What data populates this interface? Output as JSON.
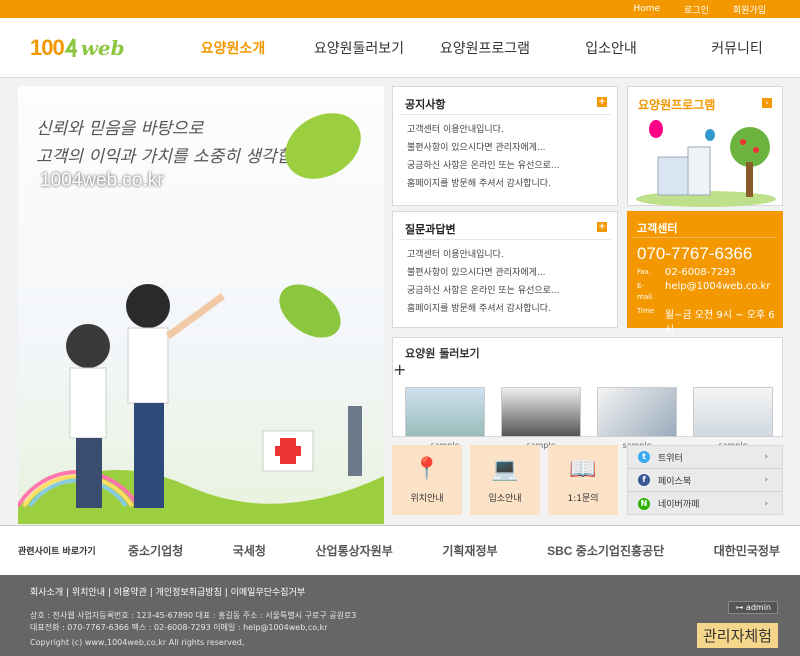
{
  "topbar": {
    "home": "Home",
    "login": "로그인",
    "join": "회원가입",
    "accent": "#f39800"
  },
  "logo": {
    "num": "100",
    "word": "web"
  },
  "nav": {
    "items": [
      "요양원소개",
      "요양원둘러보기",
      "요양원프로그램",
      "입소안내",
      "커뮤니티"
    ]
  },
  "hero": {
    "slogan1": "신뢰와 믿음을 바탕으로",
    "slogan2": "고객의 이익과 가치를 소중히 생각합니다",
    "url": "1004web.co.kr"
  },
  "notice": {
    "title": "공지사항",
    "items": [
      "고객센터 이용안내입니다.",
      "불편사항이 있으시다면 관리자에게...",
      "궁금하신 사항은 온라인 또는 유선으로...",
      "홈페이지를 방문해 주셔서 감사합니다."
    ]
  },
  "qna": {
    "title": "질문과답변",
    "items": [
      "고객센터 이용안내입니다.",
      "불편사항이 있으시다면 관리자에게...",
      "궁금하신 사항은 온라인 또는 유선으로...",
      "홈페이지를 방문해 주셔서 감사합니다."
    ]
  },
  "program": {
    "title": "요양원프로그램"
  },
  "cs": {
    "title": "고객센터",
    "tel": "070-7767-6366",
    "fax_label": "Fax.",
    "fax": "02-6008-7293",
    "email_label": "E-mail.",
    "email": "help@1004web.co.kr",
    "time_label": "Time",
    "time": "월~금 오전 9시 ~ 오후 6시"
  },
  "tour": {
    "title": "요양원 둘러보기",
    "captions": [
      "sample",
      "sample",
      "sample",
      "sample"
    ]
  },
  "quick": {
    "items": [
      "위치안내",
      "입소안내",
      "1:1문의"
    ]
  },
  "sns": {
    "items": [
      "트위터",
      "페이스북",
      "네이버까페"
    ]
  },
  "related": {
    "title": "관련사이트 바로가기",
    "logos": [
      "중소기업청",
      "국세청",
      "산업통상자원부",
      "기획재정부",
      "SBC 중소기업진흥공단",
      "대한민국정부"
    ]
  },
  "footer": {
    "links": "회사소개 | 위치안내 | 이용약관 | 개인정보취급방침 | 이메일무단수집거부",
    "line1": "상호 : 천사웹  사업자등록번호 : 123-45-67890  대표 : 홍길동  주소 : 서울특별시 구로구 공원로3",
    "line2": "대표전화 : 070-7767-6366  팩스 : 02-6008-7293  이메일 : help@1004web,co,kr",
    "copy": "Copyright (c) www,1004web,co,kr All rights reserved,",
    "admin": "⊶ admin",
    "admin_exp": "관리자체험"
  }
}
